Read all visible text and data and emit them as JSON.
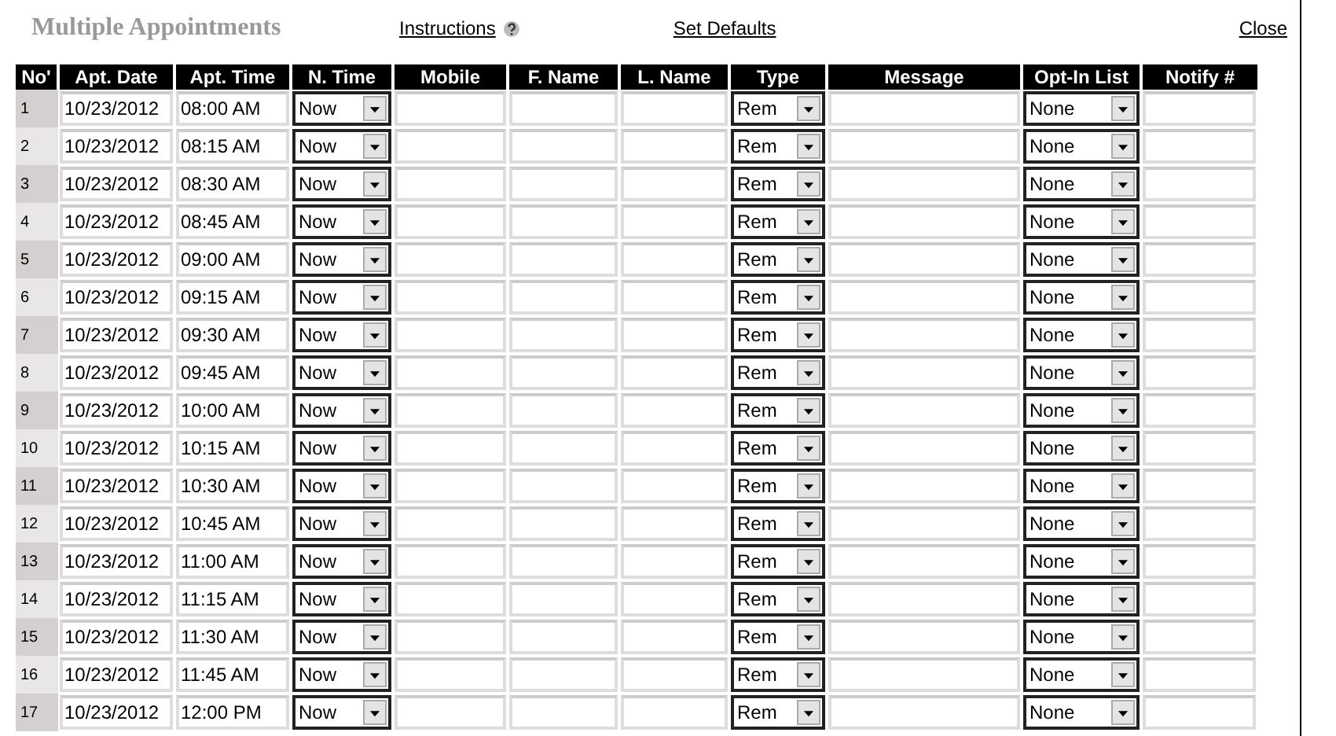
{
  "title": "Multiple Appointments",
  "links": [
    "Instructions",
    "Set Defaults",
    "Close"
  ],
  "table": {
    "columns": [
      "No'",
      "Apt. Date",
      "Apt. Time",
      "N. Time",
      "Mobile",
      "F. Name",
      "L. Name",
      "Type",
      "Message",
      "Opt-In List",
      "Notify #"
    ],
    "rows": [
      {
        "no": "1",
        "date": "10/23/2012",
        "time": "08:00 AM",
        "n_time": "Now",
        "type": "Rem",
        "opt_in": "None"
      },
      {
        "no": "2",
        "date": "10/23/2012",
        "time": "08:15 AM",
        "n_time": "Now",
        "type": "Rem",
        "opt_in": "None"
      },
      {
        "no": "3",
        "date": "10/23/2012",
        "time": "08:30 AM",
        "n_time": "Now",
        "type": "Rem",
        "opt_in": "None"
      },
      {
        "no": "4",
        "date": "10/23/2012",
        "time": "08:45 AM",
        "n_time": "Now",
        "type": "Rem",
        "opt_in": "None"
      },
      {
        "no": "5",
        "date": "10/23/2012",
        "time": "09:00 AM",
        "n_time": "Now",
        "type": "Rem",
        "opt_in": "None"
      },
      {
        "no": "6",
        "date": "10/23/2012",
        "time": "09:15 AM",
        "n_time": "Now",
        "type": "Rem",
        "opt_in": "None"
      },
      {
        "no": "7",
        "date": "10/23/2012",
        "time": "09:30 AM",
        "n_time": "Now",
        "type": "Rem",
        "opt_in": "None"
      },
      {
        "no": "8",
        "date": "10/23/2012",
        "time": "09:45 AM",
        "n_time": "Now",
        "type": "Rem",
        "opt_in": "None"
      },
      {
        "no": "9",
        "date": "10/23/2012",
        "time": "10:00 AM",
        "n_time": "Now",
        "type": "Rem",
        "opt_in": "None"
      },
      {
        "no": "10",
        "date": "10/23/2012",
        "time": "10:15 AM",
        "n_time": "Now",
        "type": "Rem",
        "opt_in": "None"
      },
      {
        "no": "11",
        "date": "10/23/2012",
        "time": "10:30 AM",
        "n_time": "Now",
        "type": "Rem",
        "opt_in": "None"
      },
      {
        "no": "12",
        "date": "10/23/2012",
        "time": "10:45 AM",
        "n_time": "Now",
        "type": "Rem",
        "opt_in": "None"
      },
      {
        "no": "13",
        "date": "10/23/2012",
        "time": "11:00 AM",
        "n_time": "Now",
        "type": "Rem",
        "opt_in": "None"
      },
      {
        "no": "14",
        "date": "10/23/2012",
        "time": "11:15 AM",
        "n_time": "Now",
        "type": "Rem",
        "opt_in": "None"
      },
      {
        "no": "15",
        "date": "10/23/2012",
        "time": "11:30 AM",
        "n_time": "Now",
        "type": "Rem",
        "opt_in": "None"
      },
      {
        "no": "16",
        "date": "10/23/2012",
        "time": "11:45 AM",
        "n_time": "Now",
        "type": "Rem",
        "opt_in": "None"
      },
      {
        "no": "17",
        "date": "10/23/2012",
        "time": "12:00 PM",
        "n_time": "Now",
        "type": "Rem",
        "opt_in": "None"
      }
    ]
  }
}
